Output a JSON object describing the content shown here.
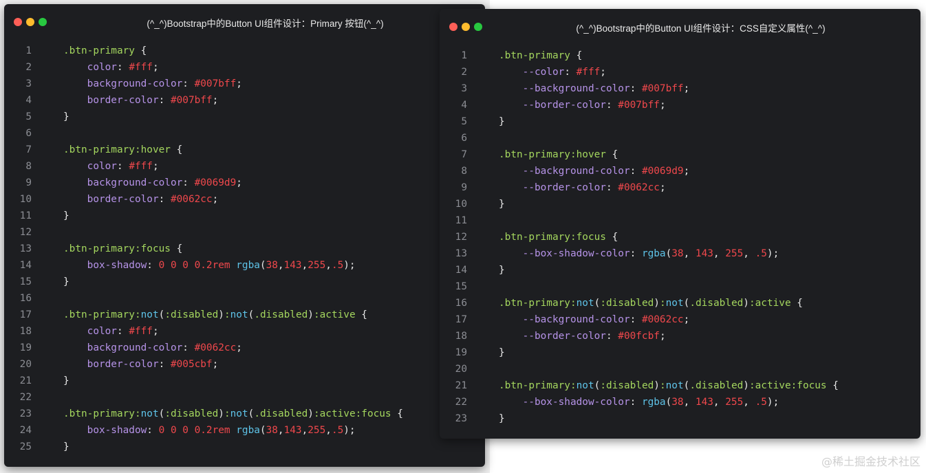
{
  "left_window": {
    "title": "(^_^)Bootstrap中的Button UI组件设计：Primary 按钮(^_^)",
    "lines": [
      [
        [
          "sel",
          ".btn-primary"
        ],
        [
          "pn",
          " {"
        ]
      ],
      [
        [
          "pn",
          "    "
        ],
        [
          "prop",
          "color"
        ],
        [
          "pn",
          ": "
        ],
        [
          "val",
          "#fff"
        ],
        [
          "pn",
          ";"
        ]
      ],
      [
        [
          "pn",
          "    "
        ],
        [
          "prop",
          "background-color"
        ],
        [
          "pn",
          ": "
        ],
        [
          "val",
          "#007bff"
        ],
        [
          "pn",
          ";"
        ]
      ],
      [
        [
          "pn",
          "    "
        ],
        [
          "prop",
          "border-color"
        ],
        [
          "pn",
          ": "
        ],
        [
          "val",
          "#007bff"
        ],
        [
          "pn",
          ";"
        ]
      ],
      [
        [
          "pn",
          "}"
        ]
      ],
      [],
      [
        [
          "sel",
          ".btn-primary:hover"
        ],
        [
          "pn",
          " {"
        ]
      ],
      [
        [
          "pn",
          "    "
        ],
        [
          "prop",
          "color"
        ],
        [
          "pn",
          ": "
        ],
        [
          "val",
          "#fff"
        ],
        [
          "pn",
          ";"
        ]
      ],
      [
        [
          "pn",
          "    "
        ],
        [
          "prop",
          "background-color"
        ],
        [
          "pn",
          ": "
        ],
        [
          "val",
          "#0069d9"
        ],
        [
          "pn",
          ";"
        ]
      ],
      [
        [
          "pn",
          "    "
        ],
        [
          "prop",
          "border-color"
        ],
        [
          "pn",
          ": "
        ],
        [
          "val",
          "#0062cc"
        ],
        [
          "pn",
          ";"
        ]
      ],
      [
        [
          "pn",
          "}"
        ]
      ],
      [],
      [
        [
          "sel",
          ".btn-primary:focus"
        ],
        [
          "pn",
          " {"
        ]
      ],
      [
        [
          "pn",
          "    "
        ],
        [
          "prop",
          "box-shadow"
        ],
        [
          "pn",
          ": "
        ],
        [
          "val",
          "0 0 0 0.2rem"
        ],
        [
          "pn",
          " "
        ],
        [
          "fn",
          "rgba"
        ],
        [
          "pn",
          "("
        ],
        [
          "val",
          "38"
        ],
        [
          "pn",
          ","
        ],
        [
          "val",
          "143"
        ],
        [
          "pn",
          ","
        ],
        [
          "val",
          "255"
        ],
        [
          "pn",
          ","
        ],
        [
          "val",
          ".5"
        ],
        [
          "pn",
          ");"
        ]
      ],
      [
        [
          "pn",
          "}"
        ]
      ],
      [],
      [
        [
          "sel",
          ".btn-primary:"
        ],
        [
          "fn",
          "not"
        ],
        [
          "pn",
          "("
        ],
        [
          "sel",
          ":disabled"
        ],
        [
          "pn",
          ")"
        ],
        [
          "sel",
          ":"
        ],
        [
          "fn",
          "not"
        ],
        [
          "pn",
          "("
        ],
        [
          "sel",
          ".disabled"
        ],
        [
          "pn",
          ")"
        ],
        [
          "sel",
          ":active"
        ],
        [
          "pn",
          " {"
        ]
      ],
      [
        [
          "pn",
          "    "
        ],
        [
          "prop",
          "color"
        ],
        [
          "pn",
          ": "
        ],
        [
          "val",
          "#fff"
        ],
        [
          "pn",
          ";"
        ]
      ],
      [
        [
          "pn",
          "    "
        ],
        [
          "prop",
          "background-color"
        ],
        [
          "pn",
          ": "
        ],
        [
          "val",
          "#0062cc"
        ],
        [
          "pn",
          ";"
        ]
      ],
      [
        [
          "pn",
          "    "
        ],
        [
          "prop",
          "border-color"
        ],
        [
          "pn",
          ": "
        ],
        [
          "val",
          "#005cbf"
        ],
        [
          "pn",
          ";"
        ]
      ],
      [
        [
          "pn",
          "}"
        ]
      ],
      [],
      [
        [
          "sel",
          ".btn-primary:"
        ],
        [
          "fn",
          "not"
        ],
        [
          "pn",
          "("
        ],
        [
          "sel",
          ":disabled"
        ],
        [
          "pn",
          ")"
        ],
        [
          "sel",
          ":"
        ],
        [
          "fn",
          "not"
        ],
        [
          "pn",
          "("
        ],
        [
          "sel",
          ".disabled"
        ],
        [
          "pn",
          ")"
        ],
        [
          "sel",
          ":active:focus"
        ],
        [
          "pn",
          " {"
        ]
      ],
      [
        [
          "pn",
          "    "
        ],
        [
          "prop",
          "box-shadow"
        ],
        [
          "pn",
          ": "
        ],
        [
          "val",
          "0 0 0 0.2rem"
        ],
        [
          "pn",
          " "
        ],
        [
          "fn",
          "rgba"
        ],
        [
          "pn",
          "("
        ],
        [
          "val",
          "38"
        ],
        [
          "pn",
          ","
        ],
        [
          "val",
          "143"
        ],
        [
          "pn",
          ","
        ],
        [
          "val",
          "255"
        ],
        [
          "pn",
          ","
        ],
        [
          "val",
          ".5"
        ],
        [
          "pn",
          ");"
        ]
      ],
      [
        [
          "pn",
          "}"
        ]
      ]
    ]
  },
  "right_window": {
    "title": "(^_^)Bootstrap中的Button UI组件设计：CSS自定义属性(^_^)",
    "lines": [
      [
        [
          "sel",
          ".btn-primary"
        ],
        [
          "pn",
          " {"
        ]
      ],
      [
        [
          "pn",
          "    "
        ],
        [
          "prop",
          "--color"
        ],
        [
          "pn",
          ": "
        ],
        [
          "val",
          "#fff"
        ],
        [
          "pn",
          ";"
        ]
      ],
      [
        [
          "pn",
          "    "
        ],
        [
          "prop",
          "--background-color"
        ],
        [
          "pn",
          ": "
        ],
        [
          "val",
          "#007bff"
        ],
        [
          "pn",
          ";"
        ]
      ],
      [
        [
          "pn",
          "    "
        ],
        [
          "prop",
          "--border-color"
        ],
        [
          "pn",
          ": "
        ],
        [
          "val",
          "#007bff"
        ],
        [
          "pn",
          ";"
        ]
      ],
      [
        [
          "pn",
          "}"
        ]
      ],
      [],
      [
        [
          "sel",
          ".btn-primary:hover"
        ],
        [
          "pn",
          " {"
        ]
      ],
      [
        [
          "pn",
          "    "
        ],
        [
          "prop",
          "--background-color"
        ],
        [
          "pn",
          ": "
        ],
        [
          "val",
          "#0069d9"
        ],
        [
          "pn",
          ";"
        ]
      ],
      [
        [
          "pn",
          "    "
        ],
        [
          "prop",
          "--border-color"
        ],
        [
          "pn",
          ": "
        ],
        [
          "val",
          "#0062cc"
        ],
        [
          "pn",
          ";"
        ]
      ],
      [
        [
          "pn",
          "}"
        ]
      ],
      [],
      [
        [
          "sel",
          ".btn-primary:focus"
        ],
        [
          "pn",
          " {"
        ]
      ],
      [
        [
          "pn",
          "    "
        ],
        [
          "prop",
          "--box-shadow-color"
        ],
        [
          "pn",
          ": "
        ],
        [
          "fn",
          "rgba"
        ],
        [
          "pn",
          "("
        ],
        [
          "val",
          "38"
        ],
        [
          "pn",
          ", "
        ],
        [
          "val",
          "143"
        ],
        [
          "pn",
          ", "
        ],
        [
          "val",
          "255"
        ],
        [
          "pn",
          ", "
        ],
        [
          "val",
          ".5"
        ],
        [
          "pn",
          ");"
        ]
      ],
      [
        [
          "pn",
          "}"
        ]
      ],
      [],
      [
        [
          "sel",
          ".btn-primary:"
        ],
        [
          "fn",
          "not"
        ],
        [
          "pn",
          "("
        ],
        [
          "sel",
          ":disabled"
        ],
        [
          "pn",
          ")"
        ],
        [
          "sel",
          ":"
        ],
        [
          "fn",
          "not"
        ],
        [
          "pn",
          "("
        ],
        [
          "sel",
          ".disabled"
        ],
        [
          "pn",
          ")"
        ],
        [
          "sel",
          ":active"
        ],
        [
          "pn",
          " {"
        ]
      ],
      [
        [
          "pn",
          "    "
        ],
        [
          "prop",
          "--background-color"
        ],
        [
          "pn",
          ": "
        ],
        [
          "val",
          "#0062cc"
        ],
        [
          "pn",
          ";"
        ]
      ],
      [
        [
          "pn",
          "    "
        ],
        [
          "prop",
          "--border-color"
        ],
        [
          "pn",
          ": "
        ],
        [
          "val",
          "#00fcbf"
        ],
        [
          "pn",
          ";"
        ]
      ],
      [
        [
          "pn",
          "}"
        ]
      ],
      [],
      [
        [
          "sel",
          ".btn-primary:"
        ],
        [
          "fn",
          "not"
        ],
        [
          "pn",
          "("
        ],
        [
          "sel",
          ":disabled"
        ],
        [
          "pn",
          ")"
        ],
        [
          "sel",
          ":"
        ],
        [
          "fn",
          "not"
        ],
        [
          "pn",
          "("
        ],
        [
          "sel",
          ".disabled"
        ],
        [
          "pn",
          ")"
        ],
        [
          "sel",
          ":active:focus"
        ],
        [
          "pn",
          " {"
        ]
      ],
      [
        [
          "pn",
          "    "
        ],
        [
          "prop",
          "--box-shadow-color"
        ],
        [
          "pn",
          ": "
        ],
        [
          "fn",
          "rgba"
        ],
        [
          "pn",
          "("
        ],
        [
          "val",
          "38"
        ],
        [
          "pn",
          ", "
        ],
        [
          "val",
          "143"
        ],
        [
          "pn",
          ", "
        ],
        [
          "val",
          "255"
        ],
        [
          "pn",
          ", "
        ],
        [
          "val",
          ".5"
        ],
        [
          "pn",
          ");"
        ]
      ],
      [
        [
          "pn",
          "}"
        ]
      ]
    ]
  },
  "watermark": "@稀土掘金技术社区",
  "colors": {
    "window_bg": "#1d1e21",
    "selector": "#a4d65e",
    "property": "#b693e8",
    "value": "#f0484c",
    "function": "#5ec3e8",
    "punctuation": "#e7e7e7",
    "line_number": "#8b8d93"
  }
}
